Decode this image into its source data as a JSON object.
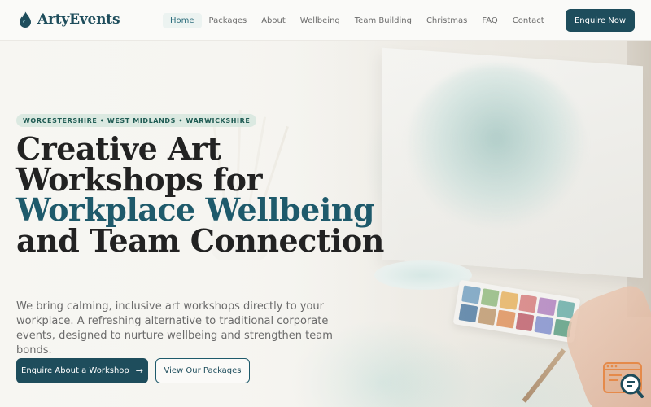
{
  "brand": {
    "name": "ArtyEvents"
  },
  "nav": {
    "items": [
      "Home",
      "Packages",
      "About",
      "Wellbeing",
      "Team Building",
      "Christmas",
      "FAQ",
      "Contact"
    ],
    "active": "Home",
    "cta_label": "Enquire Now"
  },
  "hero": {
    "badge": "WORCESTERSHIRE • WEST MIDLANDS • WARWICKSHIRE",
    "title_part1": "Creative Art Workshops for",
    "title_accent": "Workplace Wellbeing",
    "title_part2": "and Team Connection",
    "description": "We bring calming, inclusive art workshops directly to your workplace. A refreshing alternative to traditional corporate events, designed to nurture wellbeing and strengthen team bonds.",
    "primary_button": "Enquire About a Workshop",
    "secondary_button": "View Our Packages"
  },
  "icons": {
    "brand": "paint-drop-icon",
    "primary_button": "arrow-right-icon",
    "chat": "chat-search-icon"
  },
  "colors": {
    "brand": "#1e4d5c",
    "accent": "#1e5a6b",
    "badge_bg": "#d6e6de",
    "badge_text": "#1f5b53",
    "chat_widget": "#e58a4a"
  }
}
